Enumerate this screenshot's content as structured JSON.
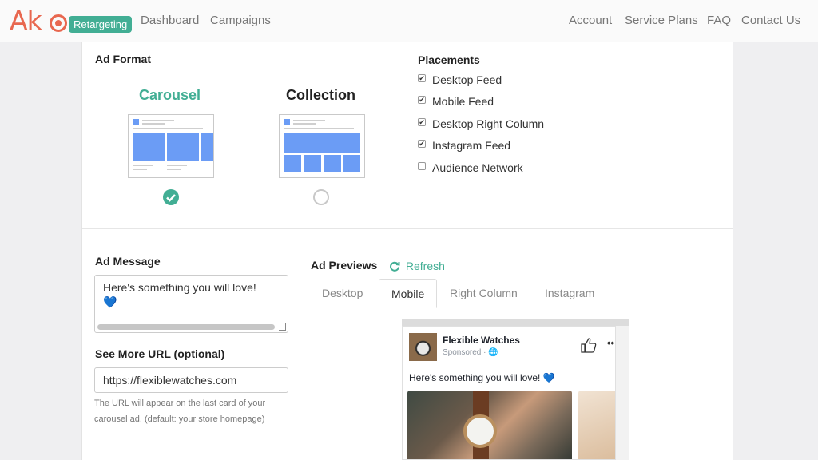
{
  "nav": {
    "logo": "Ak",
    "badge": "Retargeting",
    "left_links": [
      "Dashboard",
      "Campaigns"
    ],
    "right_links": [
      "Account",
      "Service Plans",
      "FAQ",
      "Contact Us"
    ]
  },
  "ad_format": {
    "heading": "Ad Format",
    "options": [
      {
        "label": "Carousel",
        "selected": true
      },
      {
        "label": "Collection",
        "selected": false
      }
    ],
    "accent_color": "#42ae94"
  },
  "placements": {
    "heading": "Placements",
    "items": [
      {
        "label": "Desktop Feed",
        "checked": true
      },
      {
        "label": "Mobile Feed",
        "checked": true
      },
      {
        "label": "Desktop Right Column",
        "checked": true
      },
      {
        "label": "Instagram Feed",
        "checked": true
      },
      {
        "label": "Audience Network",
        "checked": false
      }
    ]
  },
  "ad_message": {
    "heading": "Ad Message",
    "value": "Here's something you will love! 💙"
  },
  "see_more": {
    "heading": "See More URL (optional)",
    "value": "https://flexiblewatches.com",
    "help": "The URL will appear on the last card of your carousel ad. (default: your store homepage)"
  },
  "previews": {
    "heading": "Ad Previews",
    "refresh": "Refresh",
    "tabs": [
      "Desktop",
      "Mobile",
      "Right Column",
      "Instagram"
    ],
    "active_tab": "Mobile"
  },
  "fb_post": {
    "page_name": "Flexible Watches",
    "sponsored": "Sponsored · 🌐",
    "text": "Here's something you will love! 💙",
    "menu": "••"
  }
}
